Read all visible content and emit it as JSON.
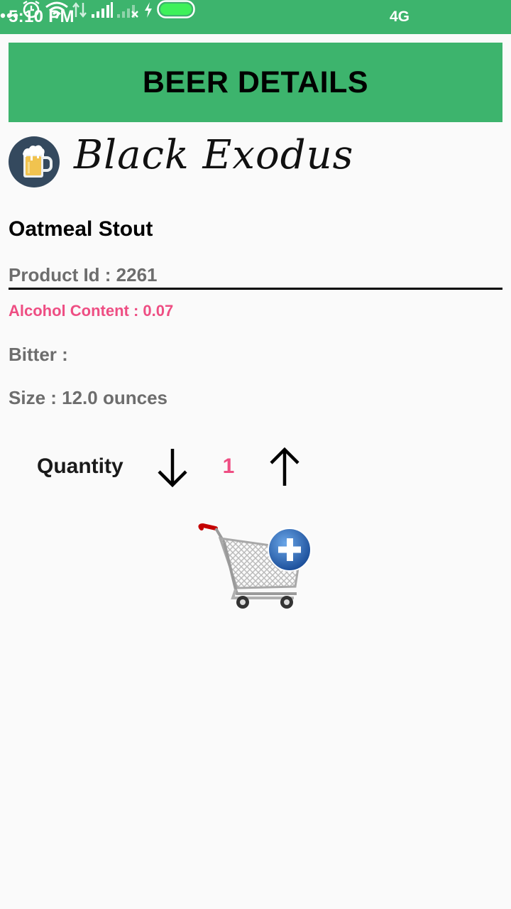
{
  "status_bar": {
    "time": "5:10 PM",
    "network": "4G",
    "icons": [
      "more-dots-icon",
      "alarm-icon",
      "wifi-icon",
      "data-transfer-icon",
      "signal-icon",
      "no-signal-icon",
      "charging-icon",
      "battery-icon"
    ]
  },
  "header": {
    "title": "BEER DETAILS"
  },
  "brand": {
    "name": "Black Exodus",
    "logo_icon": "beer-mug-icon"
  },
  "product": {
    "name": "Oatmeal Stout",
    "id_text": "Product Id : 2261",
    "alcohol_text": "Alcohol Content : 0.07",
    "bitter_text": "Bitter :",
    "size_text": "Size : 12.0 ounces"
  },
  "quantity": {
    "label": "Quantity",
    "value": "1",
    "decrease_icon": "arrow-down-icon",
    "increase_icon": "arrow-up-icon"
  },
  "cart": {
    "icon": "add-to-cart-icon"
  },
  "colors": {
    "accent_green": "#3db46d",
    "highlight_pink": "#ee4e83",
    "muted_text": "#6d6d6d"
  }
}
